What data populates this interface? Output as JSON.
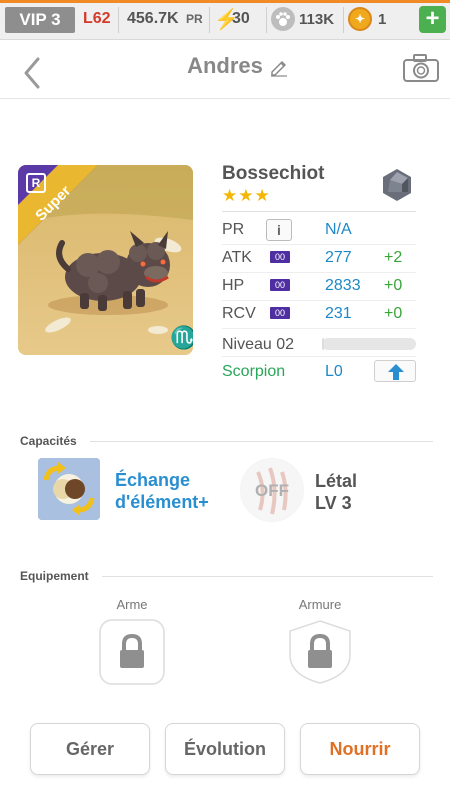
{
  "status_bar": {
    "vip": "VIP 3",
    "level": "L62",
    "pr_value": "456.7K",
    "pr_unit": "PR",
    "energy": "30",
    "food": "113K",
    "coins": "1",
    "plus": "+"
  },
  "header": {
    "title": "Andres"
  },
  "pet": {
    "rank_badge": "R",
    "rarity": "Super",
    "zodiac_symbol": "♏",
    "name": "Bossechiot",
    "stars": "★★★",
    "stats": [
      {
        "label": "PR",
        "value": "N/A",
        "bonus": ""
      },
      {
        "label": "ATK",
        "icon_text": "00",
        "value": "277",
        "bonus": "+2"
      },
      {
        "label": "HP",
        "icon_text": "00",
        "value": "2833",
        "bonus": "+0"
      },
      {
        "label": "RCV",
        "icon_text": "00",
        "value": "231",
        "bonus": "+0"
      }
    ],
    "level_label": "Niveau 02",
    "xp_fraction": 0.02,
    "sign_label": "Scorpion",
    "sign_level": "L0"
  },
  "abilities": {
    "section_title": "Capacités",
    "ability1": {
      "name_line1": "Échange",
      "name_line2": "d'élément+"
    },
    "ability2": {
      "status": "OFF",
      "name_line1": "Létal",
      "name_line2": "LV 3"
    }
  },
  "equipment": {
    "section_title": "Equipement",
    "weapon_label": "Arme",
    "armor_label": "Armure"
  },
  "buttons": {
    "manage": "Gérer",
    "evolution": "Évolution",
    "feed": "Nourrir"
  },
  "colors": {
    "accent_orange": "#e07024",
    "stat_blue": "#1e88c9",
    "bonus_green": "#3aa43a",
    "sign_green": "#2aa65a",
    "rarity_purple": "#5b3aa8",
    "rarity_gold": "#e9b830"
  },
  "icons": [
    "paw-icon",
    "bolt-icon",
    "coin-icon",
    "back-arrow-icon",
    "edit-pencil-icon",
    "camera-icon",
    "stone-element-icon",
    "info-icon",
    "upgrade-arrow-icon",
    "lock-icon"
  ]
}
